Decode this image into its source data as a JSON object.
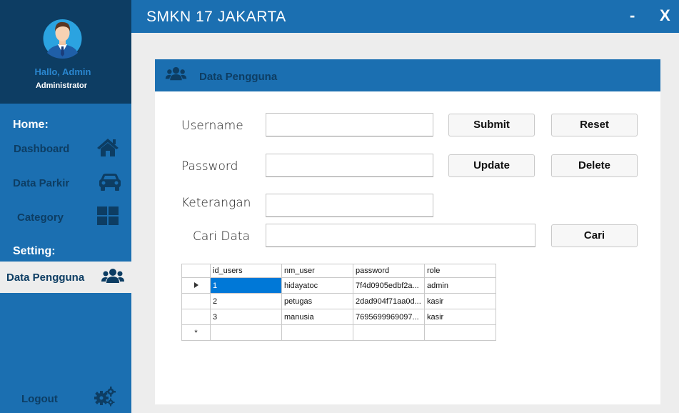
{
  "app": {
    "title": "SMKN 17 JAKARTA",
    "minimize": "-",
    "close": "X"
  },
  "profile": {
    "greeting": "Hallo, Admin",
    "role": "Administrator"
  },
  "sidebar": {
    "home_label": "Home:",
    "setting_label": "Setting:",
    "items": [
      {
        "label": "Dashboard",
        "icon": "home-icon"
      },
      {
        "label": "Data Parkir",
        "icon": "car-icon"
      },
      {
        "label": "Category",
        "icon": "grid-icon"
      },
      {
        "label": "Data Pengguna",
        "icon": "users-icon"
      },
      {
        "label": "Logout",
        "icon": "gears-icon"
      }
    ]
  },
  "panel": {
    "title": "Data Pengguna"
  },
  "form": {
    "username_label": "Username",
    "password_label": "Password",
    "keterangan_label": "Keterangan",
    "cari_label": "Cari Data",
    "username_value": "",
    "password_value": "",
    "keterangan_value": "",
    "cari_value": ""
  },
  "buttons": {
    "submit": "Submit",
    "reset": "Reset",
    "update": "Update",
    "delete": "Delete",
    "cari": "Cari"
  },
  "table": {
    "columns": [
      "id_users",
      "nm_user",
      "password",
      "role"
    ],
    "rows": [
      [
        "1",
        "hidayatoc",
        "7f4d0905edbf2a...",
        "admin"
      ],
      [
        "2",
        "petugas",
        "2dad904f71aa0d...",
        "kasir"
      ],
      [
        "3",
        "manusia",
        "7695699969097...",
        "kasir"
      ]
    ],
    "new_row_marker": "*"
  },
  "colors": {
    "primary": "#1b6fb1",
    "dark": "#0d3d63",
    "selected": "#0078d7"
  }
}
